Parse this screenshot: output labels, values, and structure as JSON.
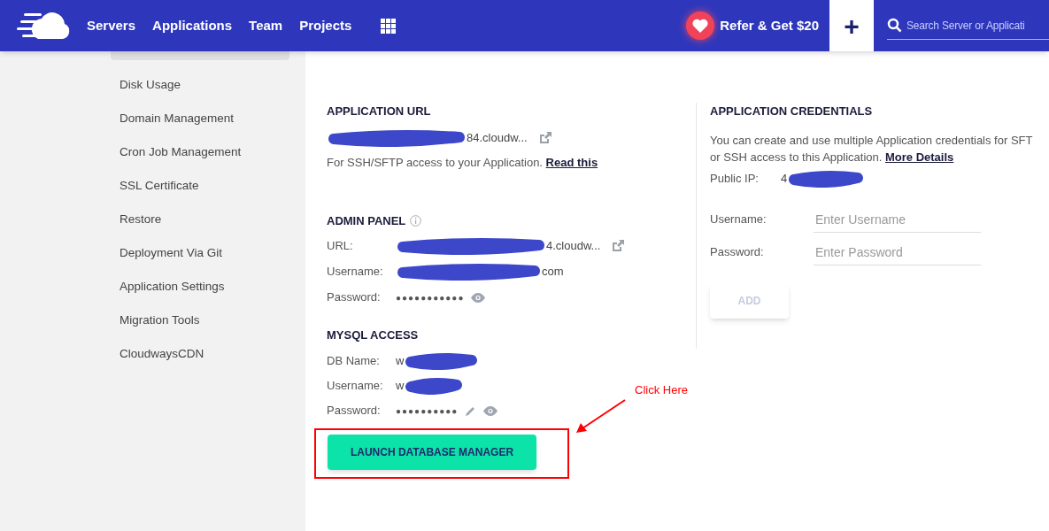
{
  "nav": {
    "links": [
      "Servers",
      "Applications",
      "Team",
      "Projects"
    ],
    "refer": "Refer & Get $20",
    "add": "+",
    "search": {
      "placeholder": "Search Server or Applicati"
    }
  },
  "sidebar": {
    "hidden_item_selected": true,
    "items": [
      {
        "label": "Disk Usage",
        "selected": false
      },
      {
        "label": "Domain Management",
        "selected": false
      },
      {
        "label": "Cron Job Management",
        "selected": false
      },
      {
        "label": "SSL Certificate",
        "selected": false
      },
      {
        "label": "Restore",
        "selected": false
      },
      {
        "label": "Deployment Via Git",
        "selected": false
      },
      {
        "label": "Application Settings",
        "selected": false
      },
      {
        "label": "Migration Tools",
        "selected": false
      },
      {
        "label": "CloudwaysCDN",
        "selected": false
      }
    ]
  },
  "app_url": {
    "title": "APPLICATION URL",
    "url": "84.cloudw...",
    "note": "For SSH/SFTP access to your Application.",
    "link": "Read this"
  },
  "admin_panel": {
    "title": "ADMIN PANEL",
    "rows": [
      {
        "label": "URL:",
        "value": "4.cloudw...",
        "kind": "link"
      },
      {
        "label": "Username:",
        "value": "com",
        "kind": "text"
      },
      {
        "label": "Password:",
        "value": "●●●●●●●●●●●",
        "kind": "password"
      }
    ]
  },
  "mysql": {
    "title": "MYSQL ACCESS",
    "rows": [
      {
        "label": "DB Name:",
        "value": "w",
        "kind": "text"
      },
      {
        "label": "Username:",
        "value": "w",
        "kind": "text"
      },
      {
        "label": "Password:",
        "value": "●●●●●●●●●●",
        "kind": "password-edit"
      }
    ],
    "button": "LAUNCH DATABASE MANAGER"
  },
  "credentials": {
    "title": "APPLICATION CREDENTIALS",
    "text": "You can create and use multiple Application credentials for SFT",
    "text2": "or SSH access to this Application.",
    "link": "More Details",
    "public_ip_label": "Public IP:",
    "public_ip": "4",
    "fields": [
      {
        "label": "Username:",
        "placeholder": "Enter Username"
      },
      {
        "label": "Password:",
        "placeholder": "Enter Password"
      }
    ],
    "button": "ADD",
    "button_disabled": true
  },
  "annotation": {
    "text": "Click Here"
  }
}
